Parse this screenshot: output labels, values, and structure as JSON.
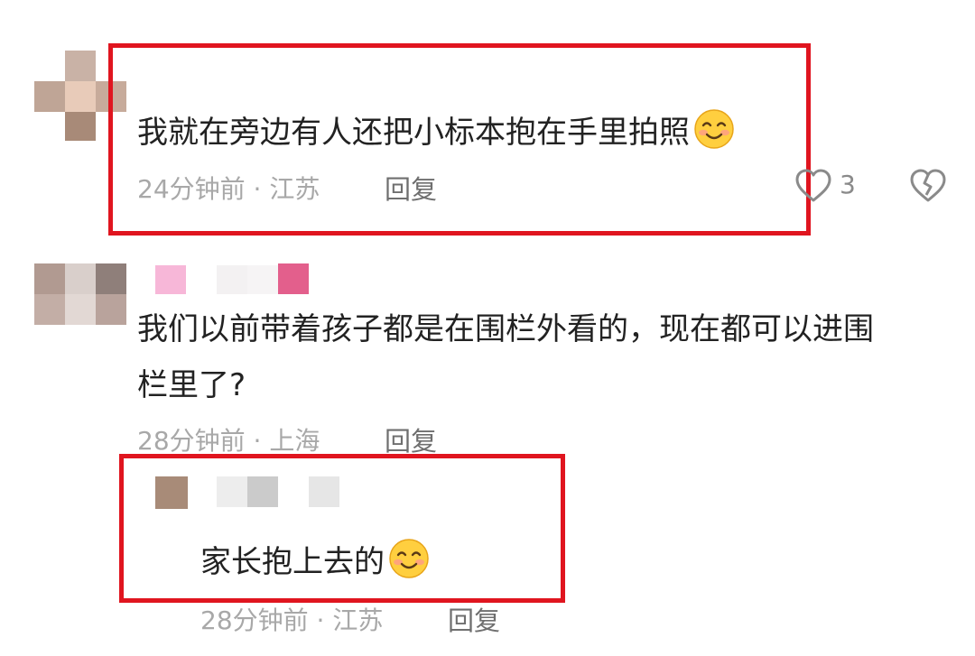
{
  "comments": [
    {
      "text": "我就在旁边有人还把小标本抱在手里拍照",
      "time_location": "24分钟前 · 江苏",
      "reply_label": "回复",
      "likes": "3"
    },
    {
      "text_line1": "我们以前带着孩子都是在围栏外看的，现在都可以进围",
      "text_line2": "栏里了?",
      "time_location": "28分钟前 · 上海",
      "reply_label": "回复"
    },
    {
      "text": "家长抱上去的",
      "time_location": "28分钟前 · 江苏",
      "reply_label": "回复"
    }
  ],
  "icons": {
    "emoji": "smiling-face-emoji",
    "like": "heart-outline-icon",
    "dislike": "broken-heart-icon"
  },
  "colors": {
    "highlight_border": "#e0151f",
    "meta_text": "#a8a8a8",
    "reply_text": "#6f6f6f"
  }
}
